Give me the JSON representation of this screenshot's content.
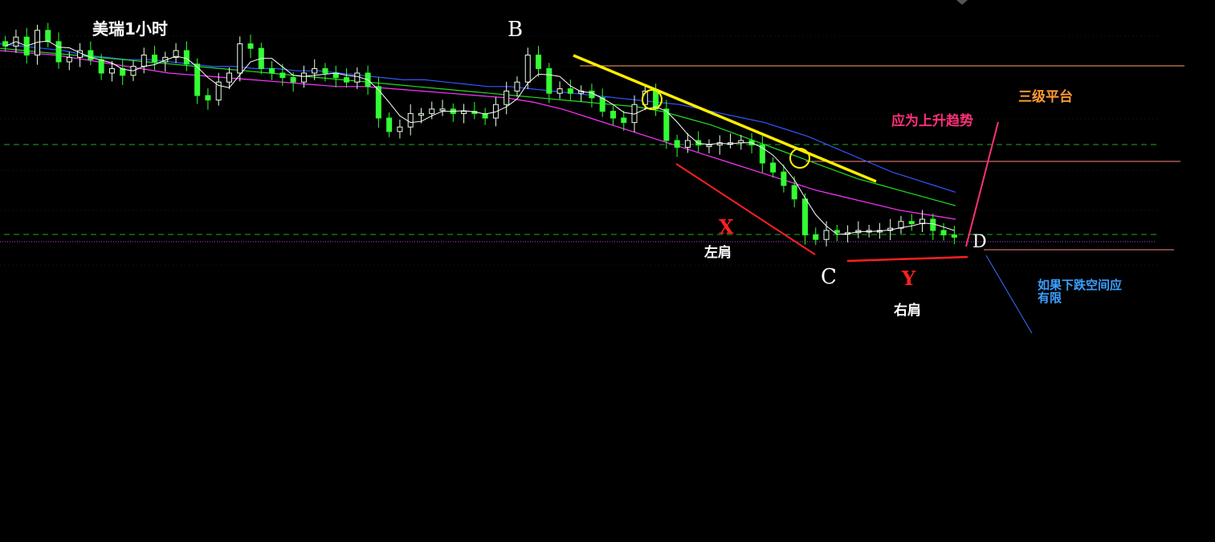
{
  "title": "美瑞1小时",
  "labels": {
    "B": "B",
    "C": "C",
    "D": "D",
    "X": "X",
    "Y": "Y",
    "left_shoulder": "左肩",
    "right_shoulder": "右肩",
    "platform": "三级平台",
    "uptrend": "应为上升趋势",
    "downside_line1": "如果下跌空间应",
    "downside_line2": "有限"
  },
  "colors": {
    "background": "#000000",
    "candle_up": "#e8ffe8",
    "candle_down": "#33ff33",
    "ma_fast": "#ffffff",
    "ma_mid": "#ff33ff",
    "ma_slow_green": "#22dd22",
    "ma_long": "#3355ff",
    "trendline": "#ffee00",
    "resistance": "#ff9955",
    "dashed_green": "#22aa22",
    "x_y_lines": "#ff2020",
    "uptrend_line": "#ff2f7a",
    "downside_line": "#3a70ff"
  },
  "chart_data": {
    "type": "line",
    "timeframe_note": "1小时",
    "series": [
      {
        "values": [
          0.92,
          0.96,
          0.88,
          0.99,
          0.94,
          0.85,
          0.87,
          0.9,
          0.86,
          0.8,
          0.82,
          0.79,
          0.83,
          0.88,
          0.85,
          0.87,
          0.9,
          0.84,
          0.7,
          0.68,
          0.76,
          0.8,
          0.93,
          0.91,
          0.82,
          0.8,
          0.78,
          0.76,
          0.8,
          0.82,
          0.8,
          0.78,
          0.76,
          0.8,
          0.74,
          0.6,
          0.54,
          0.56,
          0.62,
          0.62,
          0.64,
          0.64,
          0.62,
          0.63,
          0.62,
          0.6,
          0.66,
          0.72,
          0.76,
          0.88,
          0.82,
          0.71,
          0.73,
          0.71,
          0.72,
          0.69,
          0.63,
          0.6,
          0.58,
          0.66,
          0.72,
          0.64,
          0.5,
          0.47,
          0.5,
          0.48,
          0.48,
          0.49,
          0.49,
          0.5,
          0.48,
          0.4,
          0.36,
          0.3,
          0.24,
          0.08,
          0.06,
          0.1,
          0.09,
          0.09,
          0.1,
          0.1,
          0.1,
          0.11,
          0.14,
          0.13,
          0.15,
          0.1,
          0.08,
          0.07
        ]
      },
      {
        "values": [
          0.93,
          0.92,
          0.91,
          0.9,
          0.88,
          0.87,
          0.86,
          0.86,
          0.85,
          0.84,
          0.83,
          0.83,
          0.82,
          0.82,
          0.81,
          0.81,
          0.8,
          0.79,
          0.78,
          0.77,
          0.77,
          0.76,
          0.75,
          0.74,
          0.74,
          0.73,
          0.72,
          0.71,
          0.7,
          0.69,
          0.68,
          0.67,
          0.66,
          0.64,
          0.62,
          0.6,
          0.58,
          0.55,
          0.52,
          0.48,
          0.44,
          0.4,
          0.36,
          0.33,
          0.3,
          0.27
        ]
      },
      {
        "values": [
          0.91,
          0.9,
          0.89,
          0.88,
          0.87,
          0.86,
          0.85,
          0.84,
          0.83,
          0.82,
          0.81,
          0.8,
          0.79,
          0.78,
          0.77,
          0.76,
          0.75,
          0.74,
          0.73,
          0.72,
          0.71,
          0.7,
          0.69,
          0.68,
          0.67,
          0.66,
          0.65,
          0.63,
          0.6,
          0.57,
          0.53,
          0.49,
          0.45,
          0.41,
          0.37,
          0.33,
          0.3,
          0.27,
          0.24,
          0.21
        ]
      },
      {
        "values": [
          0.9,
          0.89,
          0.88,
          0.86,
          0.84,
          0.82,
          0.8,
          0.79,
          0.78,
          0.77,
          0.76,
          0.75,
          0.74,
          0.74,
          0.73,
          0.72,
          0.71,
          0.7,
          0.69,
          0.67,
          0.64,
          0.6,
          0.56,
          0.52,
          0.48,
          0.44,
          0.4,
          0.36,
          0.32,
          0.28,
          0.25,
          0.22,
          0.19,
          0.17,
          0.15
        ]
      }
    ],
    "levels": [
      0.82,
      0.55,
      0.3,
      0.2,
      0.16,
      0.06
    ]
  }
}
